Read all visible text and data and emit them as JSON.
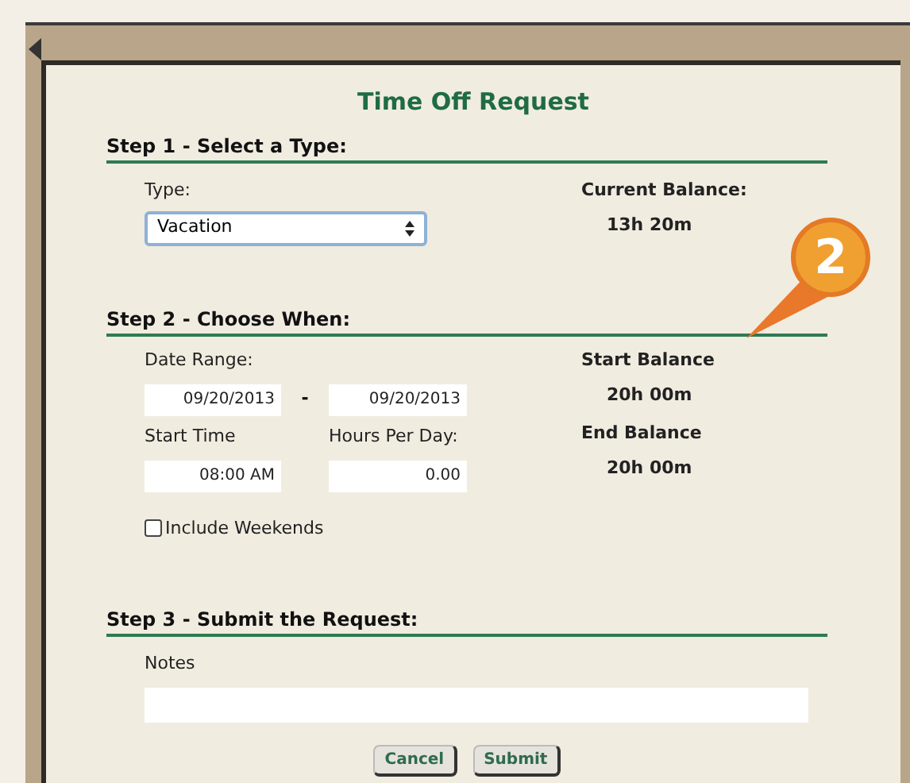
{
  "dialog": {
    "title": "Time Off Request"
  },
  "step1": {
    "heading": "Step 1 - Select a Type:",
    "type_label": "Type:",
    "type_value": "Vacation",
    "balance_label": "Current Balance:",
    "balance_value": "13h 20m"
  },
  "step2": {
    "heading": "Step 2 - Choose When:",
    "date_range_label": "Date Range:",
    "start_date": "09/20/2013",
    "separator": "-",
    "end_date": "09/20/2013",
    "start_time_label": "Start Time",
    "start_time": "08:00 AM",
    "hours_label": "Hours Per Day:",
    "hours": "0.00",
    "start_balance_label": "Start Balance",
    "start_balance": "20h 00m",
    "end_balance_label": "End Balance",
    "end_balance": "20h 00m",
    "include_weekends": {
      "label": "Include Weekends",
      "checked": false
    }
  },
  "step3": {
    "heading": "Step 3 - Submit the Request:",
    "notes_label": "Notes"
  },
  "buttons": [
    "Cancel",
    "Submit"
  ],
  "callout": {
    "number": "2"
  }
}
